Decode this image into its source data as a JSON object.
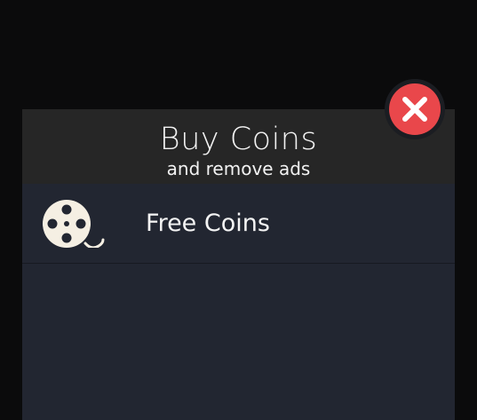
{
  "dialog": {
    "title": "Buy Coins",
    "subtitle": "and remove ads",
    "offers": [
      {
        "label": "Free Coins",
        "icon": "film-reel-icon"
      }
    ],
    "close_icon": "close-icon"
  },
  "colors": {
    "backdrop": "#0b0b0c",
    "header": "#262626",
    "panel": "#222631",
    "close_red": "#e9474b",
    "icon_cream": "#f5efe3"
  }
}
